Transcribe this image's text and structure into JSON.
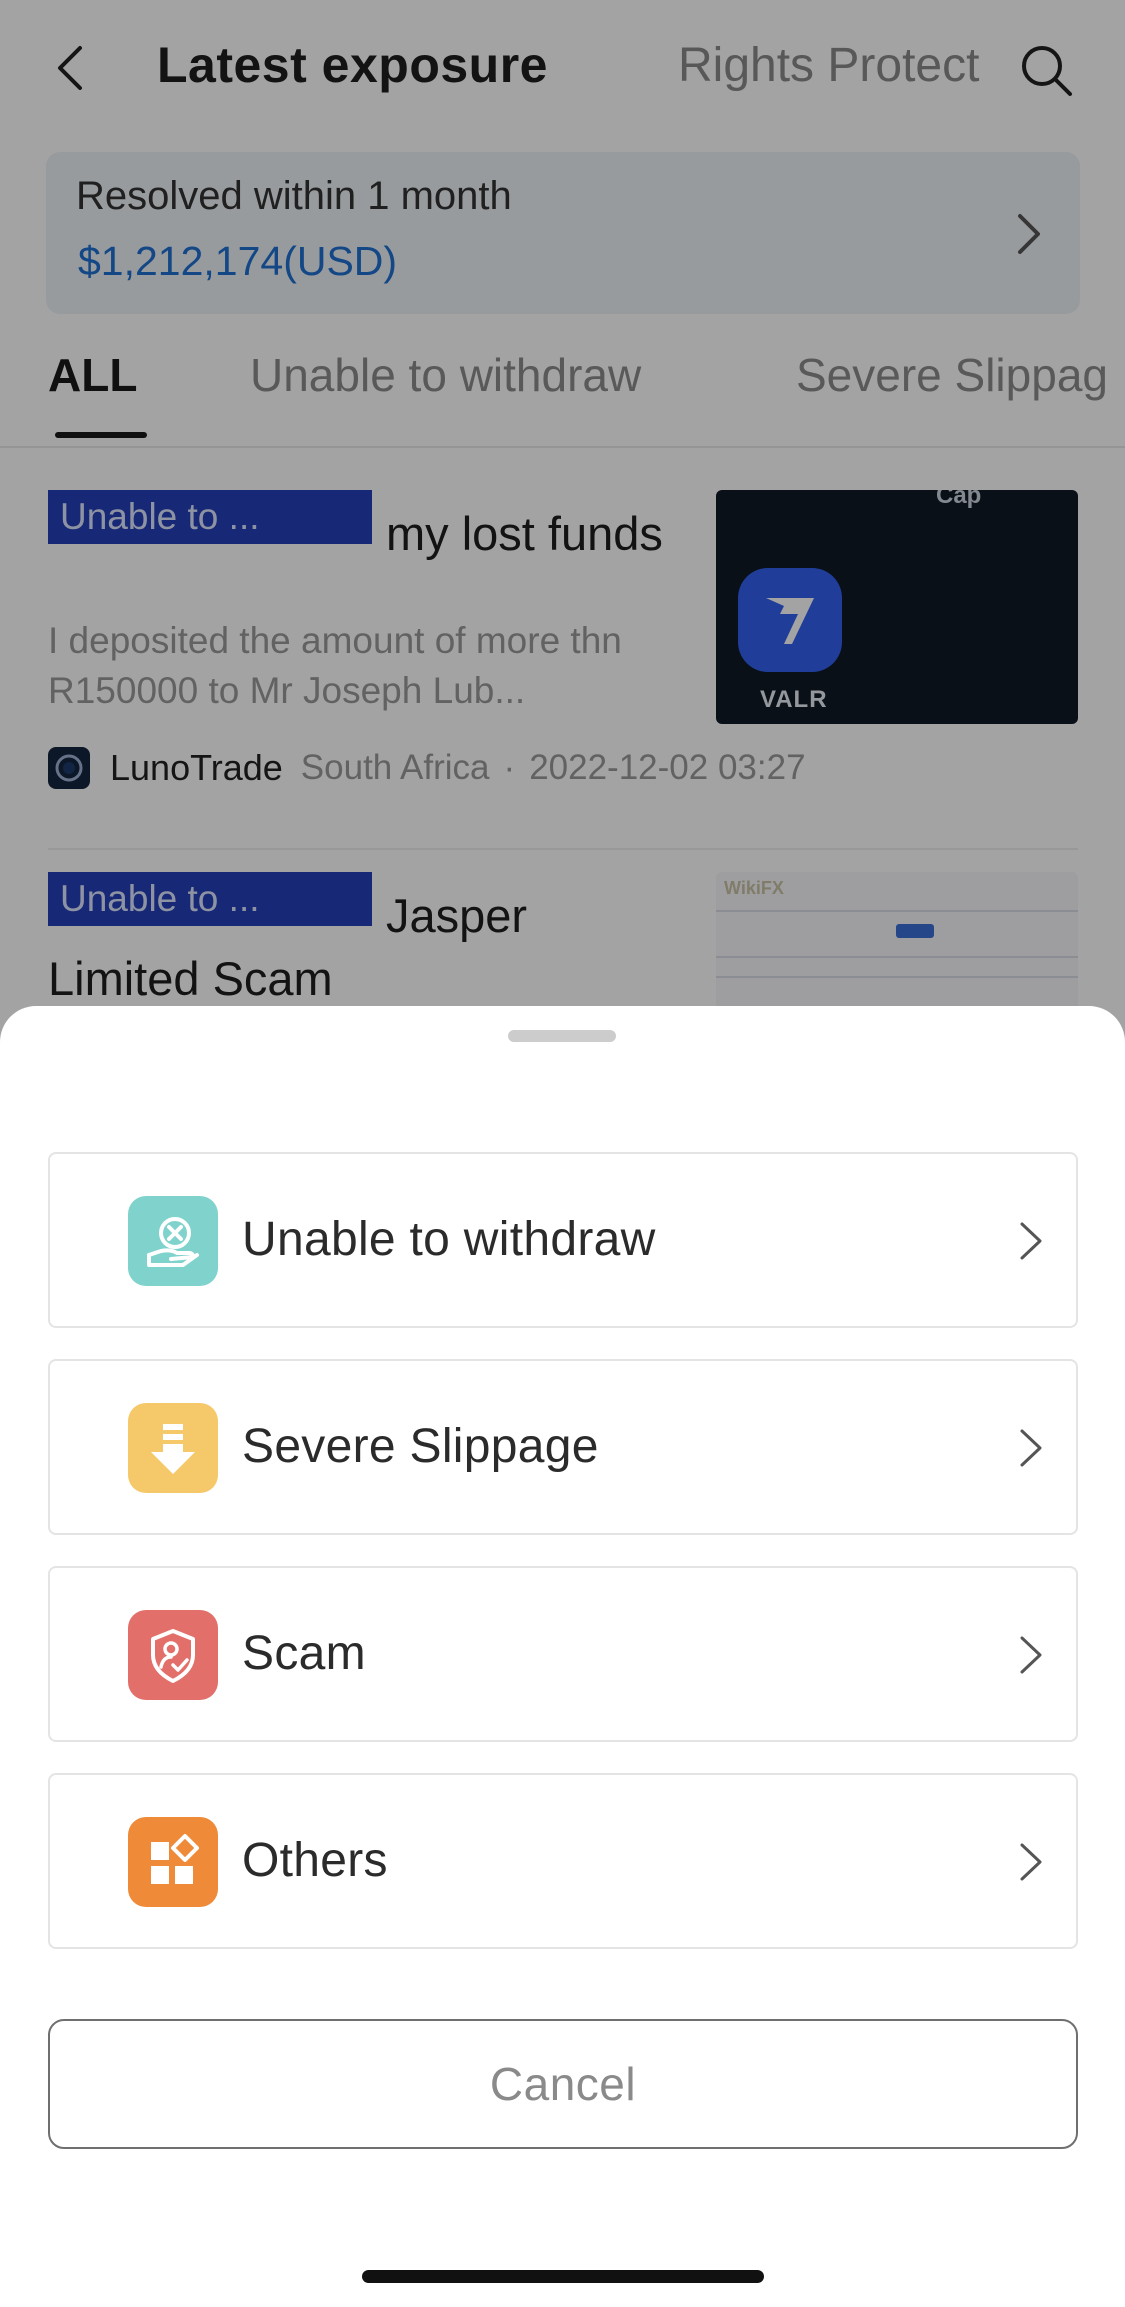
{
  "header": {
    "title": "Latest exposure",
    "secondary_tab": "Rights Protect"
  },
  "resolved": {
    "label": "Resolved within 1 month",
    "amount": "$1,212,174(USD)"
  },
  "tabs": [
    {
      "label": "ALL"
    },
    {
      "label": "Unable to withdraw"
    },
    {
      "label": "Severe Slippag"
    }
  ],
  "reports": [
    {
      "tag": "Unable to ...",
      "title": "my lost funds",
      "excerpt": "I deposited the amount of more thn R150000 to  Mr Joseph Lub...",
      "broker": "LunoTrade",
      "region": "South Africa",
      "separator": "·",
      "time": "2022-12-02 03:27",
      "thumb_label": "VALR",
      "thumb_top_label": "Cap"
    },
    {
      "tag": "Unable to ...",
      "title": "Jasper Limited Scam",
      "thumb_watermark": "WikiFX"
    }
  ],
  "sheet": {
    "options": [
      {
        "label": "Unable to withdraw",
        "icon": "hand-x-icon",
        "color": "#7fd3cc"
      },
      {
        "label": "Severe Slippage",
        "icon": "download-arrow-icon",
        "color": "#f5c86a"
      },
      {
        "label": "Scam",
        "icon": "shield-person-icon",
        "color": "#e26f6a"
      },
      {
        "label": "Others",
        "icon": "grid-diamond-icon",
        "color": "#ee8a38"
      }
    ],
    "cancel_label": "Cancel"
  }
}
